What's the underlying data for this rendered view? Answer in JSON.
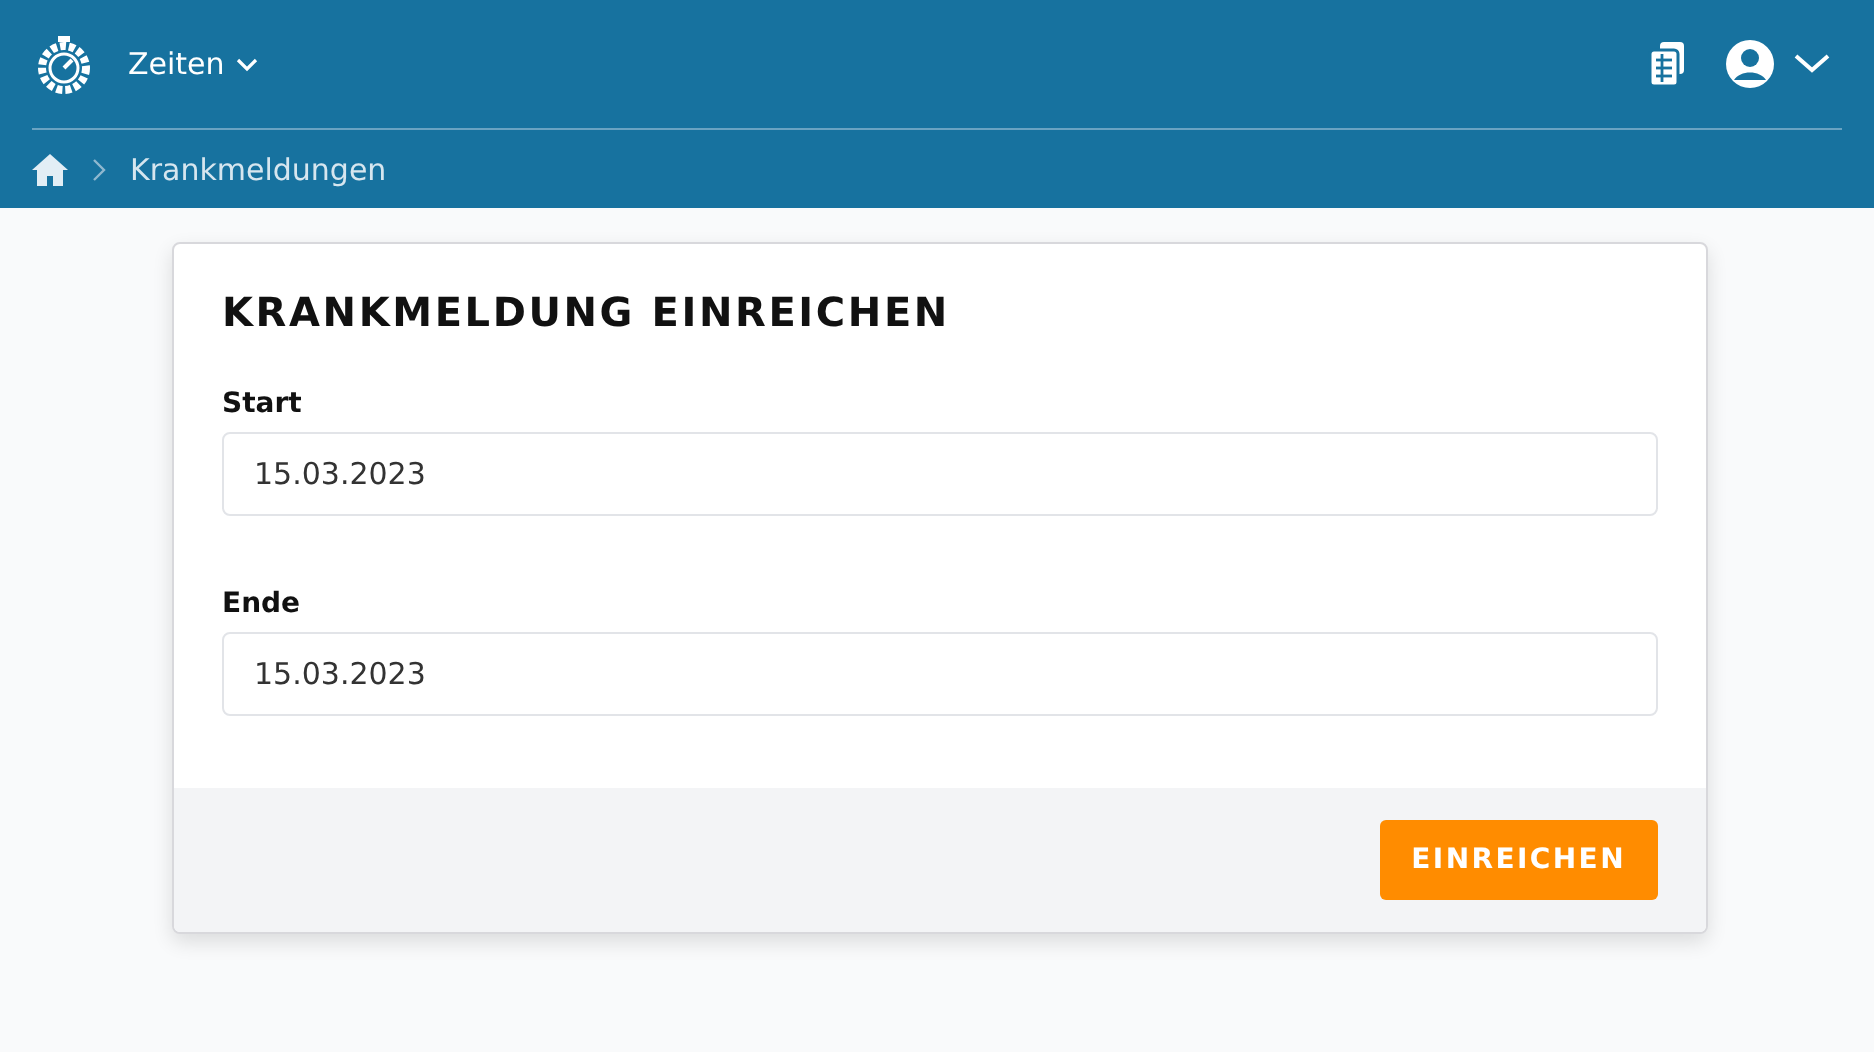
{
  "header": {
    "menu": {
      "label": "Zeiten"
    },
    "breadcrumb": [
      {
        "label": "Krankmeldungen"
      }
    ]
  },
  "form": {
    "title": "KRANKMELDUNG EINREICHEN",
    "fields": [
      {
        "label": "Start",
        "value": "15.03.2023"
      },
      {
        "label": "Ende",
        "value": "15.03.2023"
      }
    ],
    "submit": "EINREICHEN"
  }
}
